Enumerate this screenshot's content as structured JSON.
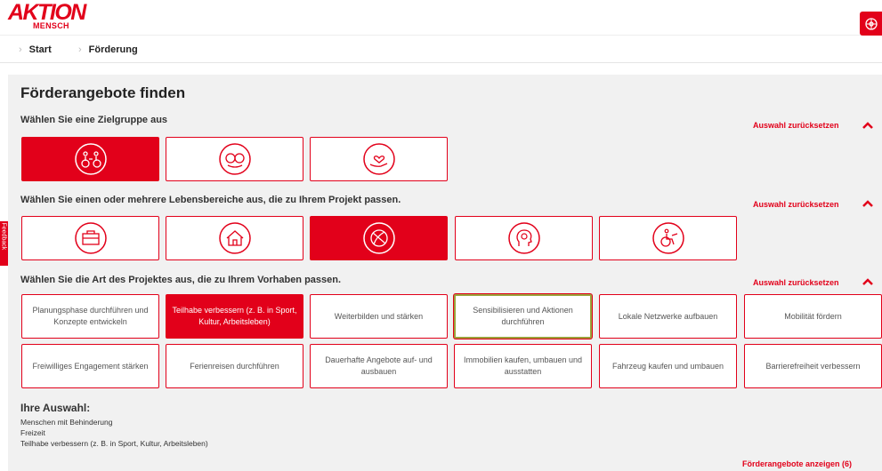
{
  "header": {
    "logo_line1": "AKTION",
    "logo_line2": "MENSCH",
    "brand_color": "#e2001a"
  },
  "breadcrumb": [
    {
      "label": "Start"
    },
    {
      "label": "Förderung"
    }
  ],
  "page_title": "Förderangebote finden",
  "reset_label": "Auswahl zurücksetzen",
  "sections": {
    "zielgruppe": {
      "label": "Wählen Sie eine Zielgruppe aus",
      "tiles": [
        {
          "icon": "people-wheelchair-icon",
          "selected": true
        },
        {
          "icon": "children-faces-icon",
          "selected": false
        },
        {
          "icon": "heart-hand-icon",
          "selected": false
        }
      ]
    },
    "lebensbereiche": {
      "label": "Wählen Sie einen oder mehrere Lebensbereiche aus, die zu Ihrem Projekt passen.",
      "tiles": [
        {
          "icon": "briefcase-icon",
          "selected": false
        },
        {
          "icon": "house-icon",
          "selected": false
        },
        {
          "icon": "ball-icon",
          "selected": true
        },
        {
          "icon": "head-lightbulb-icon",
          "selected": false
        },
        {
          "icon": "wheelchair-icon",
          "selected": false
        }
      ]
    },
    "projektart": {
      "label": "Wählen Sie die Art des Projektes aus, die zu Ihrem Vorhaben passen.",
      "options": [
        {
          "label": "Planungsphase durchführen und Konzepte entwickeln",
          "selected": false
        },
        {
          "label": "Teilhabe verbessern (z. B. in Sport, Kultur, Arbeitsleben)",
          "selected": true
        },
        {
          "label": "Weiterbilden und stärken",
          "selected": false
        },
        {
          "label": "Sensibilisieren und Aktionen durchführen",
          "selected": false,
          "focused": true
        },
        {
          "label": "Lokale Netzwerke aufbauen",
          "selected": false
        },
        {
          "label": "Mobilität fördern",
          "selected": false
        },
        {
          "label": "Freiwilliges Engagement stärken",
          "selected": false
        },
        {
          "label": "Ferienreisen durchführen",
          "selected": false
        },
        {
          "label": "Dauerhafte Angebote auf- und ausbauen",
          "selected": false
        },
        {
          "label": "Immobilien kaufen, umbauen und ausstatten",
          "selected": false
        },
        {
          "label": "Fahrzeug kaufen und umbauen",
          "selected": false
        },
        {
          "label": "Barrierefreiheit verbessern",
          "selected": false
        }
      ]
    }
  },
  "feedback_label": "Feedback",
  "selection": {
    "title": "Ihre Auswahl:",
    "items": [
      "Menschen mit Behinderung",
      "Freizeit",
      "Teilhabe verbessern (z. B. in Sport, Kultur, Arbeitsleben)"
    ]
  },
  "show_results_label": "Förderangebote anzeigen (6)"
}
